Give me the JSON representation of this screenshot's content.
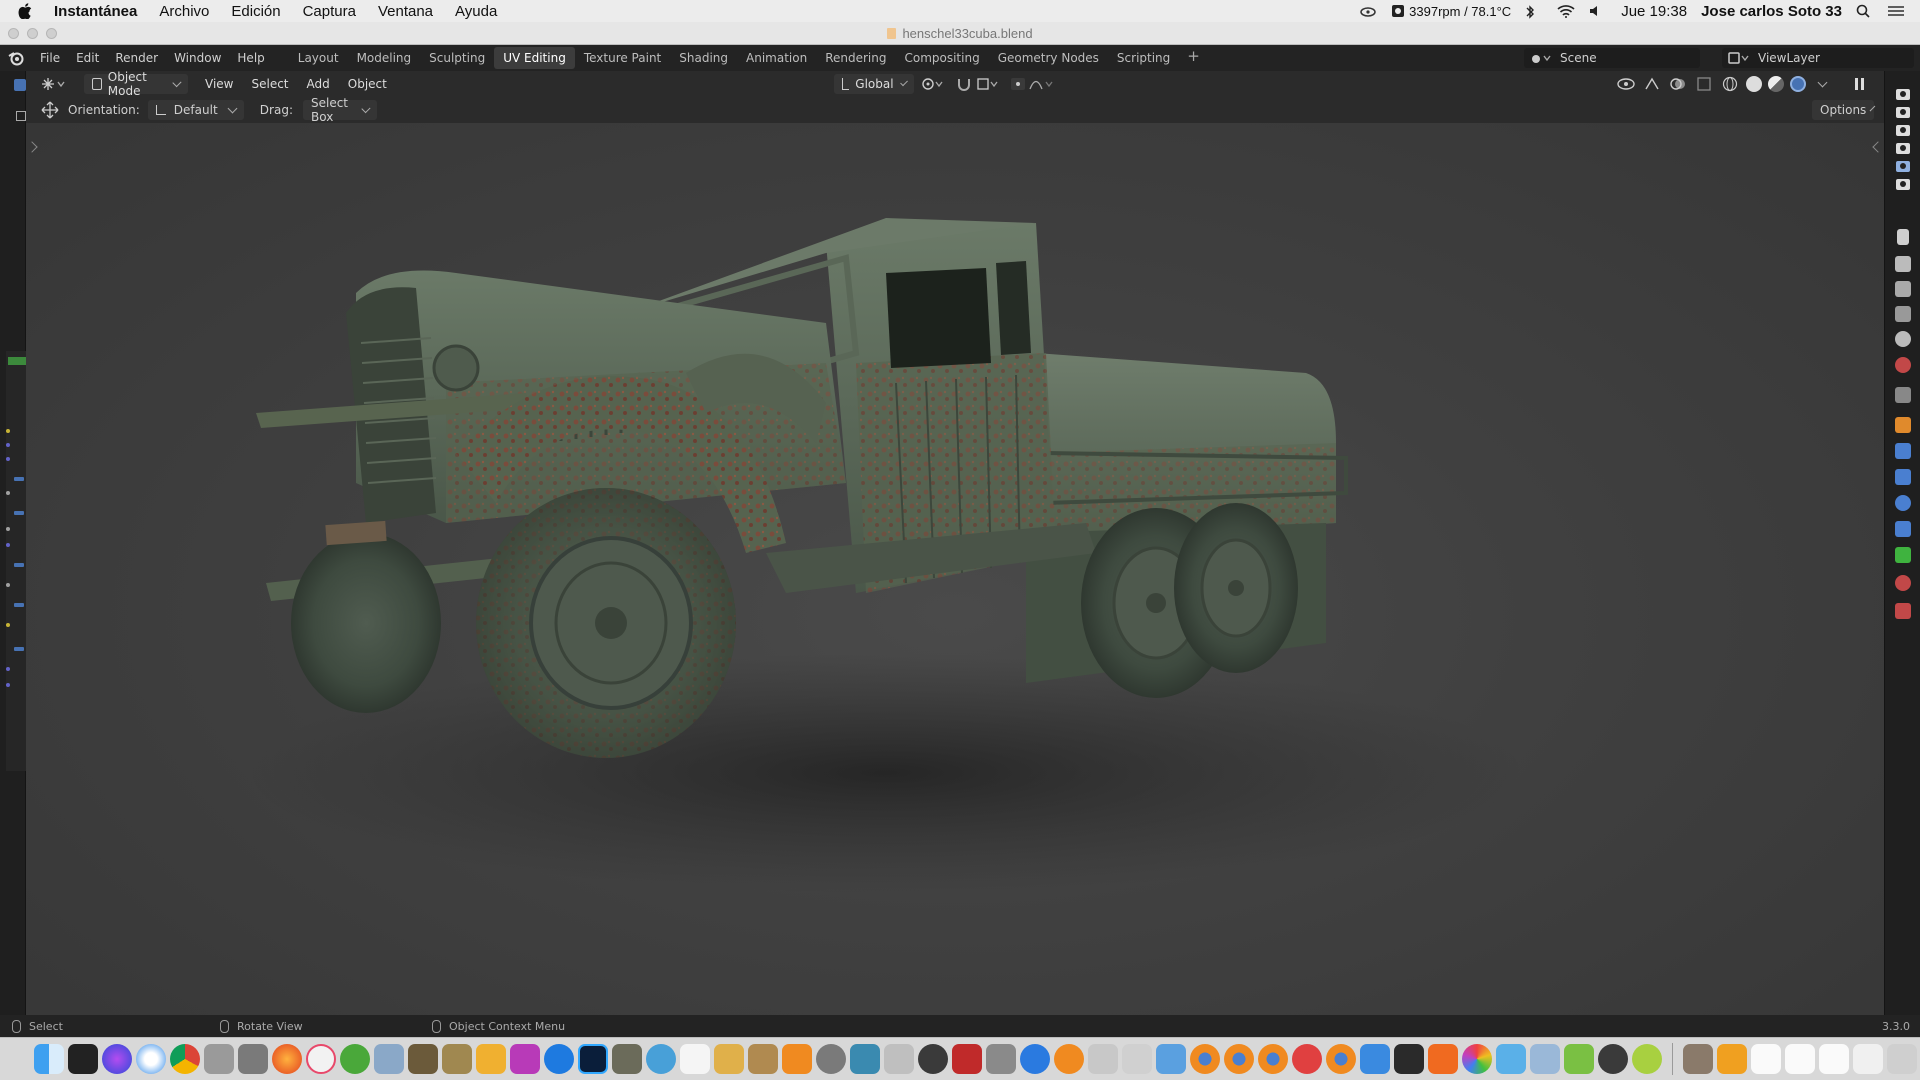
{
  "mac_menubar": {
    "app_name": "Instantánea",
    "items": [
      "Archivo",
      "Edición",
      "Captura",
      "Ventana",
      "Ayuda"
    ],
    "status": {
      "fan": "3397rpm / 78.1°C",
      "datetime": "Jue 19:38",
      "user": "Jose carlos Soto 33"
    }
  },
  "window": {
    "title": "henschel33cuba.blend"
  },
  "blender": {
    "menus": [
      "File",
      "Edit",
      "Render",
      "Window",
      "Help"
    ],
    "workspaces": [
      "Layout",
      "Modeling",
      "Sculpting",
      "UV Editing",
      "Texture Paint",
      "Shading",
      "Animation",
      "Rendering",
      "Compositing",
      "Geometry Nodes",
      "Scripting"
    ],
    "active_workspace": "UV Editing",
    "add_workspace": "+",
    "scene": "Scene",
    "view_layer": "ViewLayer"
  },
  "viewport_header": {
    "mode": "Object Mode",
    "menus": [
      "View",
      "Select",
      "Add",
      "Object"
    ],
    "transform_orientation": "Global"
  },
  "tool_header": {
    "orientation_label": "Orientation:",
    "orientation_value": "Default",
    "drag_label": "Drag:",
    "drag_value": "Select Box",
    "options": "Options"
  },
  "statusbar": {
    "select": "Select",
    "rotate": "Rotate View",
    "context": "Object Context Menu",
    "version": "3.3.0"
  },
  "viewport": {
    "content": "3D render of a weathered, rusted green military truck (Henschel 33) with tank body"
  },
  "colors": {
    "accent_blue": "#4772b3",
    "truck_green": "#5b6b58",
    "rust": "#7a4a3a",
    "viewport_bg": "#404040"
  }
}
